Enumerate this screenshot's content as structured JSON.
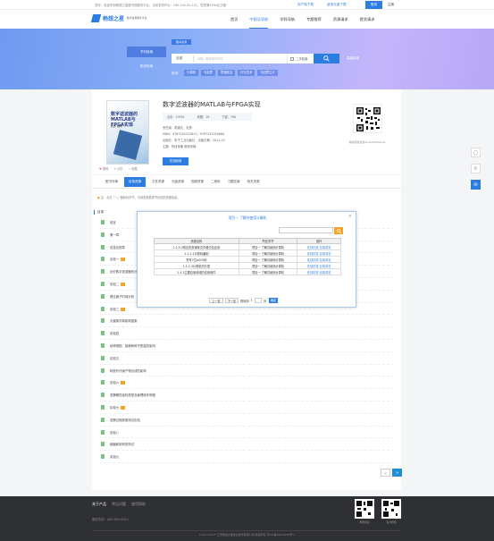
{
  "topbar": {
    "message": "您好，欢迎来到畅想之星图书馆服务平台，当前机构IP为：180.104.45.221，您是第4394位访客！",
    "client_download": "用户端下载",
    "cd_download": "虚拟光盘下载",
    "login": "登录",
    "register": "注册"
  },
  "brand": {
    "name": "畅想之星",
    "subtitle": "数字资源服务平台"
  },
  "nav": [
    "首页",
    "中图法导航",
    "学科导航",
    "专题推荐",
    "资源请求",
    "提交请求"
  ],
  "search": {
    "tabs": [
      "书刊检索",
      "知识检索"
    ],
    "book_label": "图书资源",
    "scope": "全部",
    "placeholder": "请输入要检索的内容",
    "secondary": "二次检索",
    "advanced": "高级检索",
    "hot_label": "热词：",
    "hot_words": [
      "计算机",
      "马克思",
      "思想政治",
      "行为艺术",
      "马克思主义"
    ]
  },
  "book": {
    "title": "数字滤波器的MATLAB与FPGA实现",
    "cover_title": "数字滤波器的MATLAB与FPGA实现",
    "cover_sub": "杜勇 编著",
    "stats": [
      "点击：10591",
      "收藏：16",
      "下载：798"
    ],
    "author": "责任者：蔺建元，杜勇",
    "isbn": "ISBN：9787304322621；9787121159688",
    "publisher": "出版社：电子工业出版社　出版日期：2012.03",
    "category": "主题：有线传输 射频传输",
    "read_button": "在线阅读",
    "actions": [
      "推荐",
      "分享",
      "收藏"
    ],
    "qr_caption": "移动阅读支持Android/iPhone"
  },
  "tabs": [
    "图书详情",
    "目录资源",
    "文件资源",
    "光盘资源",
    "视频资源",
    "二维码",
    "习题答案",
    "相关资源"
  ],
  "notice": {
    "prefix": "注：点击「",
    "highlight": "+",
    "suffix": "」图标标识节，可浏览查看该节对应的资源信息。"
  },
  "toc": {
    "heading": "目录",
    "items": [
      {
        "title": "前言",
        "locked": false
      },
      {
        "title": "第一章",
        "locked": false
      },
      {
        "title": "信息论指导",
        "locked": false
      },
      {
        "title": "实验一",
        "locked": true
      },
      {
        "title": "划分数字滤波器的分类",
        "locked": false
      },
      {
        "title": "实验二",
        "locked": true
      },
      {
        "title": "理论离子时域分析",
        "locked": false
      },
      {
        "title": "实验三",
        "locked": true
      },
      {
        "title": "灭菌条件和影响因素",
        "locked": false
      },
      {
        "title": "实验四",
        "locked": false
      },
      {
        "title": "培养基配、接种和种子质量的影响",
        "locked": false
      },
      {
        "title": "实验五",
        "locked": false
      },
      {
        "title": "种鼠代代谢产物合成的影响",
        "locked": false
      },
      {
        "title": "实验六",
        "locked": true
      },
      {
        "title": "发酵罐的结构类型及管理操作规程",
        "locked": false
      },
      {
        "title": "实验七",
        "locked": true
      },
      {
        "title": "发酵过程参数测试实验",
        "locked": false
      },
      {
        "title": "实验八",
        "locked": false
      },
      {
        "title": "细菌和制剂的测试",
        "locked": false
      },
      {
        "title": "实验九",
        "locked": false
      }
    ]
  },
  "modal": {
    "title": "项目一 了解并使用计算机",
    "columns": [
      "资源名称",
      "所在章节",
      "操作"
    ],
    "rows": [
      {
        "name": "1.2.5.4常见的多媒体文件格式及应用",
        "chapter": "项目一 了解并使用计算机",
        "ops": "在线浏览 目录浏览"
      },
      {
        "name": "1.1.2.1计算机编制",
        "chapter": "项目一 了解并使用计算机",
        "ops": "在线浏览 目录浏览"
      },
      {
        "name": "符号7位ASCII码",
        "chapter": "项目一 了解并使用计算机",
        "ops": "在线浏览 目录浏览"
      },
      {
        "name": "1.1.2.3计算机的分类",
        "chapter": "项目一 了解并使用计算机",
        "ops": "在线浏览 目录浏览"
      },
      {
        "name": "1.4.3主要应用领域的应用软件",
        "chapter": "项目一 了解并使用计算机",
        "ops": "在线浏览 目录浏览"
      }
    ],
    "pager": {
      "prev": "上一页",
      "next": "下一页",
      "jump_label": "跳转到",
      "page": "1",
      "unit": "页",
      "go": "确定"
    }
  },
  "pager": {
    "prev": "<",
    "next": ">"
  },
  "footer": {
    "links": [
      "关于产品",
      "常见问题",
      "使用帮助"
    ],
    "tel": "服务热线：400-600-6011",
    "copyright": "©2017-2027 江苏畅想之星信息技术有限公司 版权所有 苏ICP备18029209号-1",
    "qr_captions": [
      "畅想阅读",
      "官方微博"
    ]
  }
}
